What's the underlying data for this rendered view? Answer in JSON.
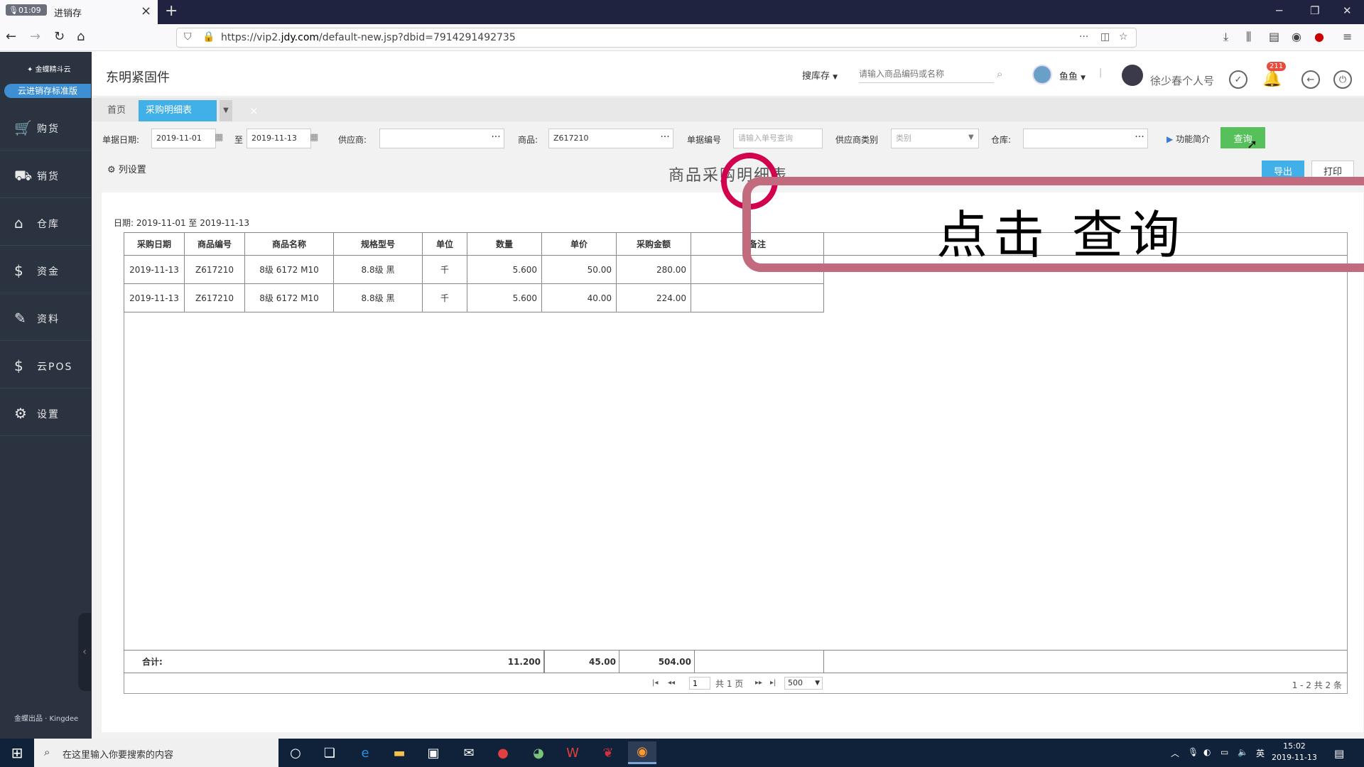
{
  "browser": {
    "tab_recording_time": "01:09",
    "tab_title": "进销存",
    "url_prefix": "https://vip2.",
    "url_domain": "jdy.com",
    "url_path": "/default-new.jsp?dbid=7914291492735"
  },
  "sidebar": {
    "logo": "金蝶精斗云",
    "edition": "云进销存标准版",
    "items": [
      {
        "label": "购货",
        "icon": "cart-icon"
      },
      {
        "label": "销货",
        "icon": "sales-icon"
      },
      {
        "label": "仓库",
        "icon": "warehouse-icon"
      },
      {
        "label": "资金",
        "icon": "money-icon"
      },
      {
        "label": "资料",
        "icon": "pen-icon"
      },
      {
        "label": "云POS",
        "icon": "pos-icon"
      },
      {
        "label": "设置",
        "icon": "gear-icon"
      }
    ],
    "footer": "金蝶出品 · Kingdee"
  },
  "header": {
    "company": "东明紧固件",
    "search_type": "搜库存",
    "search_placeholder": "请输入商品编码或名称",
    "user_small": "鱼鱼",
    "user_name": "徐少春个人号",
    "notification_count": "211"
  },
  "tabs": {
    "home": "首页",
    "active": "采购明细表"
  },
  "filters": {
    "doc_date_label": "单据日期:",
    "date_from": "2019-11-01",
    "date_to_label": "至",
    "date_to": "2019-11-13",
    "supplier_label": "供应商:",
    "supplier_value": "",
    "product_label": "商品:",
    "product_value": "Z617210",
    "doc_no_label": "单据编号",
    "doc_no_placeholder": "请输入单号查询",
    "supplier_cat_label": "供应商类别",
    "supplier_cat_placeholder": "类别",
    "warehouse_label": "仓库:",
    "warehouse_value": "",
    "func_intro": "功能简介",
    "query_btn": "查询"
  },
  "toolbar": {
    "column_settings": "列设置",
    "report_title": "商品采购明细表",
    "export_btn": "导出",
    "print_btn": "打印"
  },
  "report": {
    "date_range": "日期: 2019-11-01 至 2019-11-13",
    "columns": [
      "采购日期",
      "商品编号",
      "商品名称",
      "规格型号",
      "单位",
      "数量",
      "单价",
      "采购金额",
      "备注"
    ],
    "rows": [
      {
        "date": "2019-11-13",
        "code": "Z617210",
        "name": "8级 6172 M10",
        "spec": "8.8级 黑",
        "unit": "千",
        "qty": "5.600",
        "price": "50.00",
        "amount": "280.00",
        "note": ""
      },
      {
        "date": "2019-11-13",
        "code": "Z617210",
        "name": "8级 6172 M10",
        "spec": "8.8级 黑",
        "unit": "千",
        "qty": "5.600",
        "price": "40.00",
        "amount": "224.00",
        "note": ""
      }
    ],
    "total_label": "合计:",
    "total_qty": "11.200",
    "total_price": "45.00",
    "total_amount": "504.00"
  },
  "pager": {
    "page": "1",
    "total_pages": "共 1 页",
    "page_size": "500",
    "record_info": "1 - 2  共 2 条"
  },
  "overlay": {
    "callout": "点击 查询"
  },
  "taskbar": {
    "search_placeholder": "在这里输入你要搜索的内容",
    "ime": "英",
    "time": "15:02",
    "date": "2019-11-13"
  },
  "colors": {
    "sidebar_bg": "#2b3340",
    "accent_blue": "#42b0e8",
    "query_green": "#56c05a",
    "highlight_red": "#d3004f",
    "callout_border": "#c26b7e"
  }
}
